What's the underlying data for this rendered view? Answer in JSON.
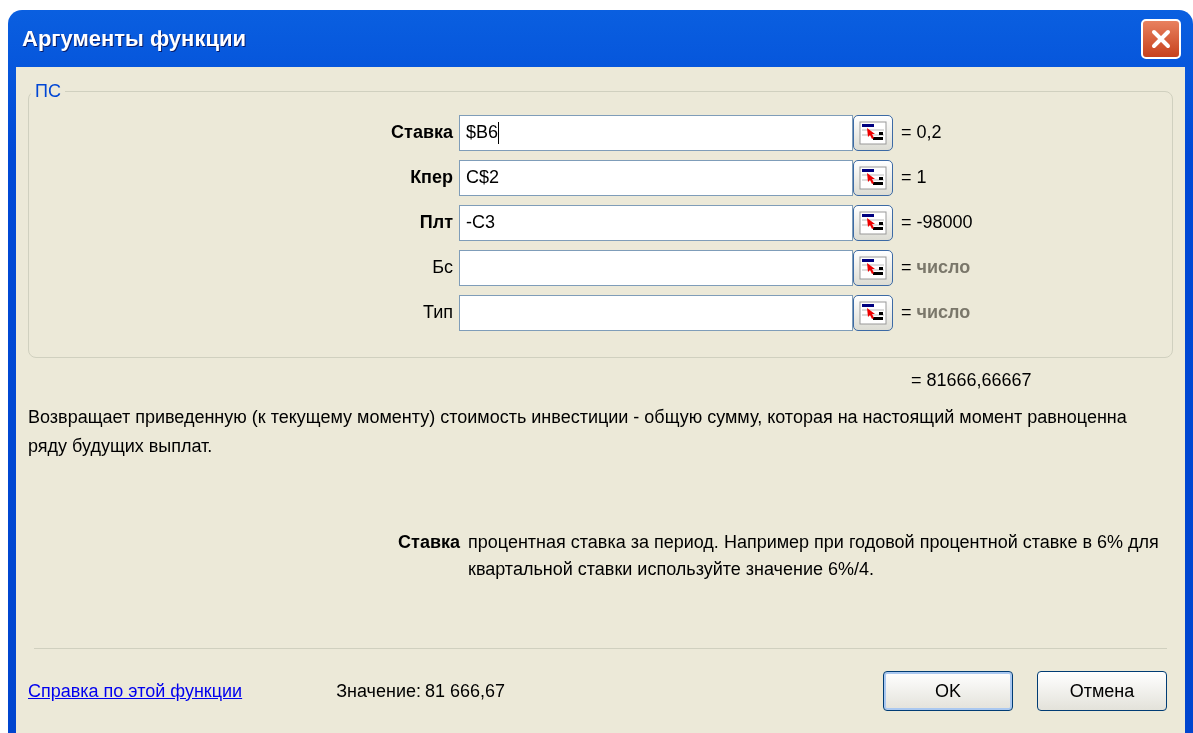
{
  "window": {
    "title": "Аргументы функции"
  },
  "function_group": {
    "name": "ПС",
    "arguments": [
      {
        "label": "Ставка",
        "required": true,
        "value": "$B6",
        "focused": true,
        "result": {
          "text": "= 0,2",
          "kind": "value"
        }
      },
      {
        "label": "Кпер",
        "required": true,
        "value": "C$2",
        "focused": false,
        "result": {
          "text": "= 1",
          "kind": "value"
        }
      },
      {
        "label": "Плт",
        "required": true,
        "value": "-C3",
        "focused": false,
        "result": {
          "text": "= -98000",
          "kind": "value"
        }
      },
      {
        "label": "Бс",
        "required": false,
        "focused": false,
        "result": {
          "text": "= ",
          "hint": "число",
          "kind": "type_hint"
        }
      },
      {
        "label": "Тип",
        "required": false,
        "focused": false,
        "result": {
          "text": "= ",
          "hint": "число",
          "kind": "type_hint"
        }
      }
    ]
  },
  "formula_result": "= 81666,66667",
  "description": "Возвращает приведенную (к текущему моменту) стоимость инвестиции - общую сумму, которая на настоящий момент равноценна ряду будущих выплат.",
  "argument_help": {
    "label": "Ставка",
    "text": "процентная ставка за период. Например при годовой процентной ставке в 6% для квартальной ставки используйте значение 6%/4."
  },
  "footer": {
    "help_link": "Справка по этой функции",
    "value_label": "Значение:",
    "value": "81 666,67",
    "buttons": [
      "OK",
      "Отмена"
    ]
  }
}
